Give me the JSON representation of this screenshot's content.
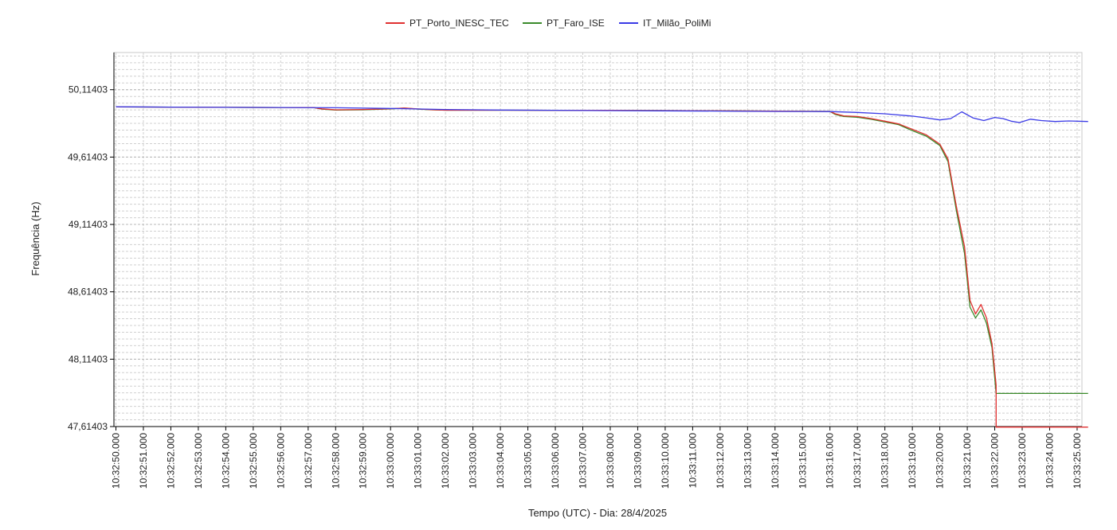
{
  "chart_data": {
    "type": "line",
    "title": "",
    "xlabel": "Tempo (UTC) - Dia: 28/4/2025",
    "ylabel": "Frequência (Hz)",
    "x_ticks": [
      "10:32:50.000",
      "10:32:51.000",
      "10:32:52.000",
      "10:32:53.000",
      "10:32:54.000",
      "10:32:55.000",
      "10:32:56.000",
      "10:32:57.000",
      "10:32:58.000",
      "10:32:59.000",
      "10:33:00.000",
      "10:33:01.000",
      "10:33:02.000",
      "10:33:03.000",
      "10:33:04.000",
      "10:33:05.000",
      "10:33:06.000",
      "10:33:07.000",
      "10:33:08.000",
      "10:33:09.000",
      "10:33:10.000",
      "10:33:11.000",
      "10:33:12.000",
      "10:33:13.000",
      "10:33:14.000",
      "10:33:15.000",
      "10:33:16.000",
      "10:33:17.000",
      "10:33:18.000",
      "10:33:19.000",
      "10:33:20.000",
      "10:33:21.000",
      "10:33:22.000",
      "10:33:23.000",
      "10:33:24.000",
      "10:33:25.000"
    ],
    "x_range_seconds": [
      0,
      35.4
    ],
    "y_ticks": [
      "47,61403",
      "48,11403",
      "48,61403",
      "49,11403",
      "49,61403",
      "50,11403"
    ],
    "y_tick_values": [
      47.61403,
      48.11403,
      48.61403,
      49.11403,
      49.61403,
      50.11403
    ],
    "ylim": [
      47.61403,
      50.39
    ],
    "grid": true,
    "legend_position": "top",
    "series": [
      {
        "name": "PT_Porto_INESC_TEC",
        "color": "#e03030",
        "x": [
          0,
          2,
          4,
          6,
          7.2,
          7.5,
          8,
          9,
          10,
          10.5,
          11,
          11.5,
          12,
          13,
          14,
          16,
          18,
          20,
          22,
          24,
          26,
          26.2,
          26.5,
          27,
          27.5,
          28,
          28.5,
          29,
          29.5,
          30,
          30.3,
          30.6,
          30.9,
          31.1,
          31.3,
          31.5,
          31.7,
          31.9,
          32.05,
          32.05,
          35.4
        ],
        "values": [
          49.986,
          49.985,
          49.983,
          49.982,
          49.981,
          49.972,
          49.965,
          49.967,
          49.973,
          49.978,
          49.971,
          49.966,
          49.962,
          49.962,
          49.962,
          49.961,
          49.961,
          49.959,
          49.957,
          49.955,
          49.953,
          49.935,
          49.92,
          49.915,
          49.9,
          49.88,
          49.86,
          49.82,
          49.78,
          49.71,
          49.6,
          49.25,
          48.95,
          48.55,
          48.45,
          48.52,
          48.42,
          48.23,
          47.92,
          47.61,
          47.61
        ]
      },
      {
        "name": "PT_Faro_ISE",
        "color": "#3a8a2a",
        "x": [
          0,
          2,
          4,
          6,
          7.2,
          7.5,
          8,
          9,
          10,
          10.5,
          11,
          11.5,
          12,
          13,
          14,
          16,
          18,
          20,
          22,
          24,
          26,
          26.2,
          26.5,
          27,
          27.5,
          28,
          28.5,
          29,
          29.5,
          30,
          30.3,
          30.6,
          30.9,
          31.1,
          31.3,
          31.5,
          31.7,
          31.9,
          32.05,
          35.4
        ],
        "values": [
          49.986,
          49.985,
          49.983,
          49.982,
          49.981,
          49.97,
          49.963,
          49.965,
          49.972,
          49.977,
          49.97,
          49.965,
          49.962,
          49.962,
          49.962,
          49.961,
          49.961,
          49.959,
          49.957,
          49.955,
          49.953,
          49.93,
          49.915,
          49.91,
          49.895,
          49.875,
          49.855,
          49.81,
          49.77,
          49.7,
          49.58,
          49.22,
          48.9,
          48.5,
          48.42,
          48.48,
          48.38,
          48.2,
          47.86,
          47.86
        ]
      },
      {
        "name": "IT_Milão_PoliMi",
        "color": "#3a3ae6",
        "x": [
          0,
          2,
          4,
          6,
          8,
          10,
          12,
          14,
          16,
          18,
          20,
          22,
          24,
          26,
          27,
          28,
          29,
          29.5,
          30,
          30.4,
          30.8,
          31.2,
          31.6,
          32,
          32.3,
          32.6,
          32.9,
          33.3,
          33.7,
          34.2,
          34.7,
          35.4
        ],
        "values": [
          49.987,
          49.985,
          49.983,
          49.982,
          49.98,
          49.975,
          49.967,
          49.963,
          49.961,
          49.959,
          49.957,
          49.955,
          49.953,
          49.952,
          49.945,
          49.935,
          49.918,
          49.905,
          49.89,
          49.9,
          49.95,
          49.905,
          49.885,
          49.908,
          49.9,
          49.88,
          49.87,
          49.895,
          49.885,
          49.878,
          49.882,
          49.878
        ]
      }
    ]
  }
}
